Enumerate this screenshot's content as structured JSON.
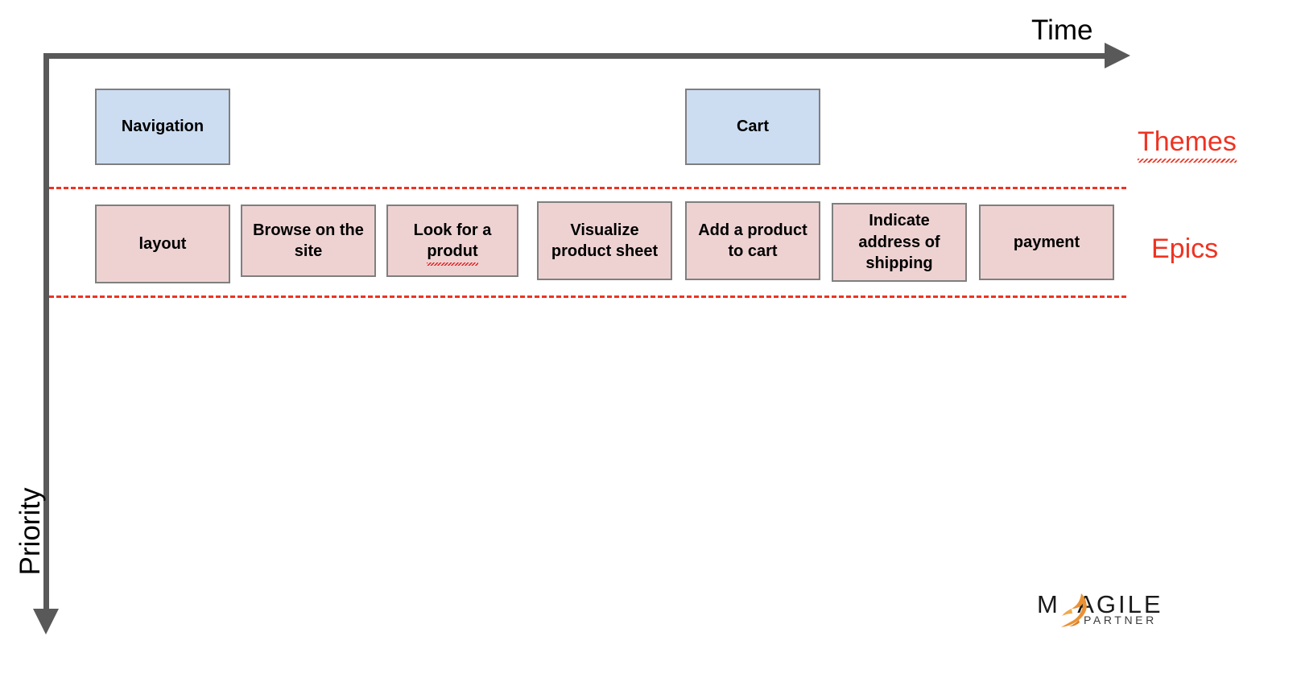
{
  "diagram": {
    "axes": {
      "x_label": "Time",
      "y_label": "Priority",
      "axis_color": "#595959"
    },
    "row_labels": {
      "themes": "Themes",
      "epics": "Epics",
      "label_color": "#ee3322"
    },
    "colors": {
      "theme_fill": "#ccddf2",
      "epic_fill": "#eed2d2",
      "box_border": "#7f7f7f",
      "dashed_line": "#ee3322",
      "logo_accent": "#eb9133"
    },
    "themes": [
      {
        "label": "Navigation"
      },
      {
        "label": "Cart"
      }
    ],
    "epics": [
      {
        "label": "layout"
      },
      {
        "label": "Browse on the site"
      },
      {
        "label_line1": "Look for a",
        "label_line2": "produt",
        "misspelled": true
      },
      {
        "label": "Visualize product sheet"
      },
      {
        "label": "Add a product to cart"
      },
      {
        "label": "Indicate address of shipping"
      },
      {
        "label": "payment"
      }
    ]
  },
  "logo": {
    "wordmark_my": "M",
    "wordmark_y": "Y",
    "wordmark_agile": "AGILE",
    "subtext": "PARTNER"
  }
}
